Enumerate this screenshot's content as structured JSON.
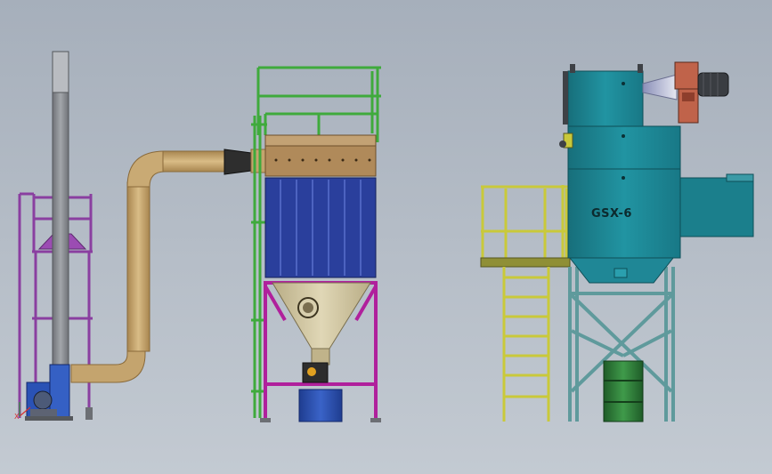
{
  "scene": {
    "background_top": "#a6afbb",
    "background_bottom": "#c3cad2",
    "collector_label": "GSX-6",
    "axis_label": "X"
  },
  "colors": {
    "stack": "#8e9095",
    "stack_frame": "#8a3fa0",
    "duct": "#c4a46e",
    "railing_green": "#3faa3c",
    "bag_house_body": "#2a3f9c",
    "bag_house_top": "#b08a5a",
    "hopper": "#cfc4a0",
    "frame_magenta": "#b0209c",
    "drum_blue": "#2b4fb3",
    "collector_teal": "#1d8a98",
    "platform_yellow": "#c9c93a",
    "leg_teal": "#5f9a9c",
    "drum_green": "#2e7d3a",
    "motor_red": "#c0634a",
    "fan_blue": "#2a52b5"
  }
}
